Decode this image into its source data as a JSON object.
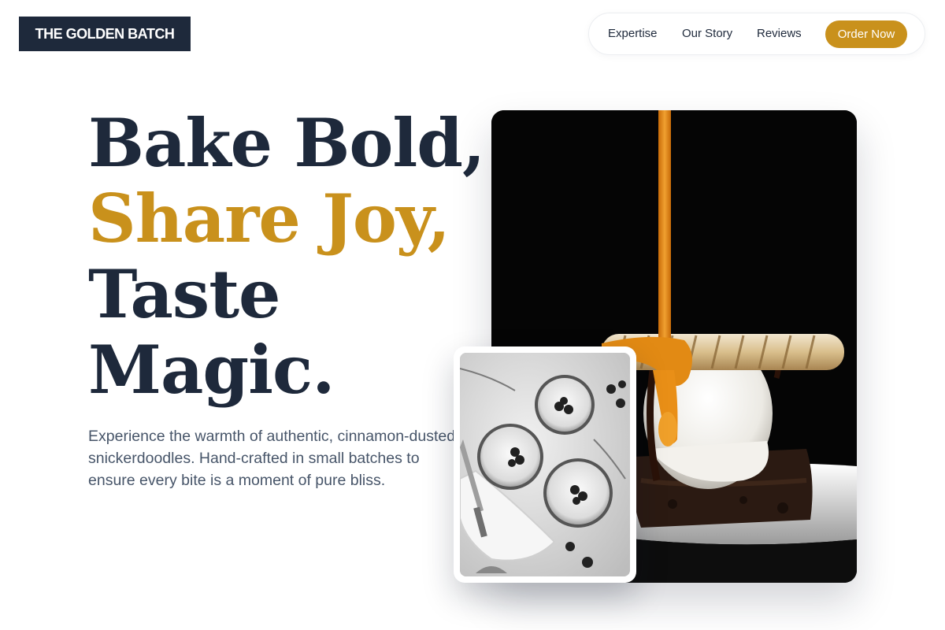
{
  "brand": {
    "name": "THE GOLDEN BATCH"
  },
  "nav": {
    "links": [
      {
        "label": "Expertise"
      },
      {
        "label": "Our Story"
      },
      {
        "label": "Reviews"
      }
    ],
    "cta_label": "Order Now"
  },
  "hero": {
    "headline": {
      "line1": "Bake Bold,",
      "line2": "Share Joy,",
      "line3": "Taste",
      "line4": "Magic."
    },
    "tagline": "Experience the warmth of authentic, cinnamon-dusted snickerdoodles. Hand-crafted in small batches to ensure every bite is a moment of pure bliss.",
    "images": {
      "main": "caramel-drizzle-dessert-photo",
      "inset": "berry-tarts-photo"
    }
  },
  "colors": {
    "navy": "#1e293b",
    "gold": "#c9911c",
    "body_text": "#475569",
    "background": "#ffffff"
  }
}
